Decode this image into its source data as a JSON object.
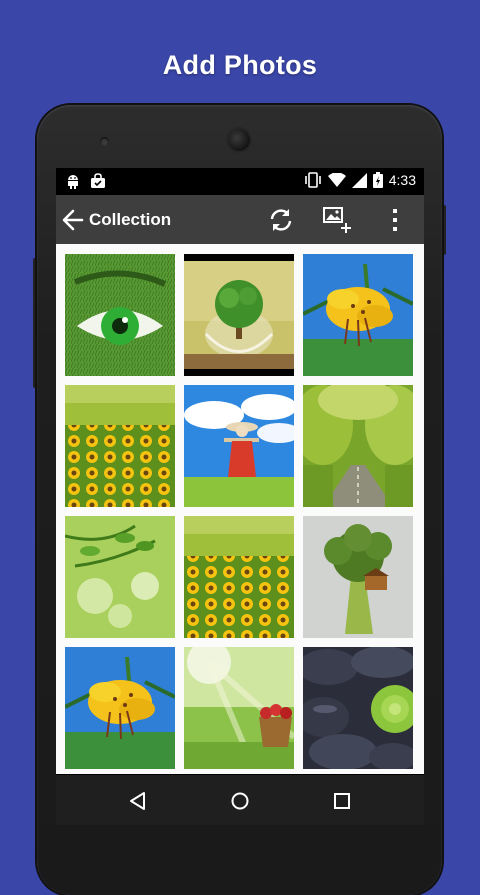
{
  "promo": {
    "headline": "Add Photos"
  },
  "status_bar": {
    "time": "4:33"
  },
  "toolbar": {
    "title": "Collection"
  },
  "gallery": {
    "tiles": [
      {
        "subject": "green eye in grass"
      },
      {
        "subject": "tree in glass globe"
      },
      {
        "subject": "yellow lily"
      },
      {
        "subject": "sunflower field"
      },
      {
        "subject": "scarecrow in meadow"
      },
      {
        "subject": "tree tunnel road"
      },
      {
        "subject": "green leaves bokeh"
      },
      {
        "subject": "sunflower field"
      },
      {
        "subject": "broccoli treehouse"
      },
      {
        "subject": "yellow lily"
      },
      {
        "subject": "apple basket in sunlight"
      },
      {
        "subject": "black stones with green flower"
      }
    ]
  },
  "colors": {
    "background": "#3a46a8",
    "toolbar": "#3e3e3e",
    "content": "#fbfbfb"
  }
}
